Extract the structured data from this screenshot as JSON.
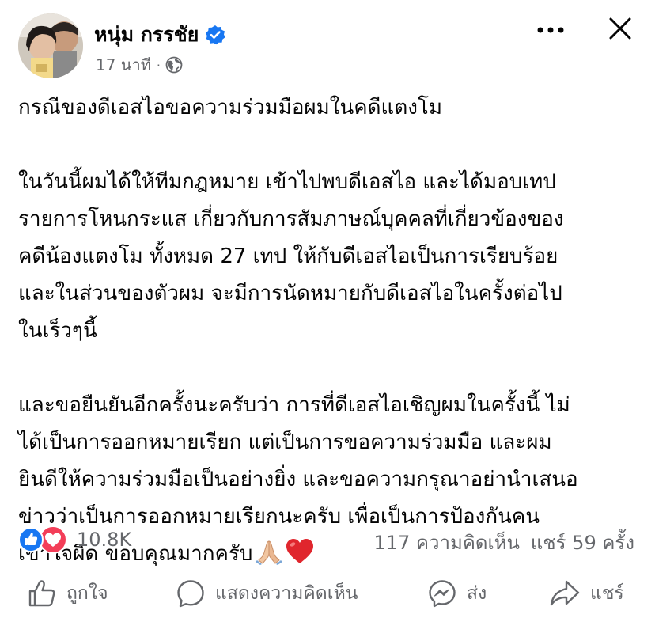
{
  "author": {
    "name": "หนุ่ม กรรชัย",
    "verified": true,
    "avatar": "avatar-photo"
  },
  "meta": {
    "time": "17 นาที",
    "separator": "·",
    "audience_icon": "globe-icon"
  },
  "header": {
    "more_icon": "more-horizontal-icon",
    "close_icon": "close-icon"
  },
  "post": {
    "paragraphs": [
      "กรณีของดีเอสไอขอความร่วมมือผมในคดีแตงโม",
      "ในวันนี้ผมได้ให้ทีมกฎหมาย  เข้าไปพบดีเอสไอ และได้มอบเทป\nรายการโหนกระแส เกี่ยวกับการสัมภาษณ์บุคคลที่เกี่ยวข้องของ\nคดีน้องแตงโม ทั้งหมด 27 เทป ให้กับดีเอสไอเป็นการเรียบร้อย\nและในส่วนของตัวผม จะมีการนัดหมายกับดีเอสไอในครั้งต่อไป\nในเร็วๆนี้",
      "และขอยืนยันอีกครั้งนะครับว่า การที่ดีเอสไอเชิญผมในครั้งนี้ ไม่\nได้เป็นการออกหมายเรียก แต่เป็นการขอความร่วมมือ และผม\nยินดีให้ความร่วมมือเป็นอย่างยิ่ง และขอความกรุณาอย่านำเสนอ\nข่าวว่าเป็นการออกหมายเรียกนะครับ เพื่อเป็นการป้องกันคน\nเข้าใจผิด ขอบคุณมากครับ"
    ],
    "trailing_emojis": [
      "folded-hands-emoji",
      "red-heart-emoji"
    ]
  },
  "summary": {
    "reaction_icons": [
      "like-reaction-icon",
      "love-reaction-icon"
    ],
    "reaction_count": "10.8K",
    "comments": "117 ความคิดเห็น",
    "shares": "แชร์ 59 ครั้ง"
  },
  "actions": {
    "like": "ถูกใจ",
    "comment": "แสดงความคิดเห็น",
    "send": "ส่ง",
    "share": "แชร์"
  },
  "colors": {
    "text": "#050505",
    "secondary": "#65676b",
    "verified_blue": "#1877f2",
    "love_red": "#f33e58",
    "heart_red": "#e0262d"
  }
}
